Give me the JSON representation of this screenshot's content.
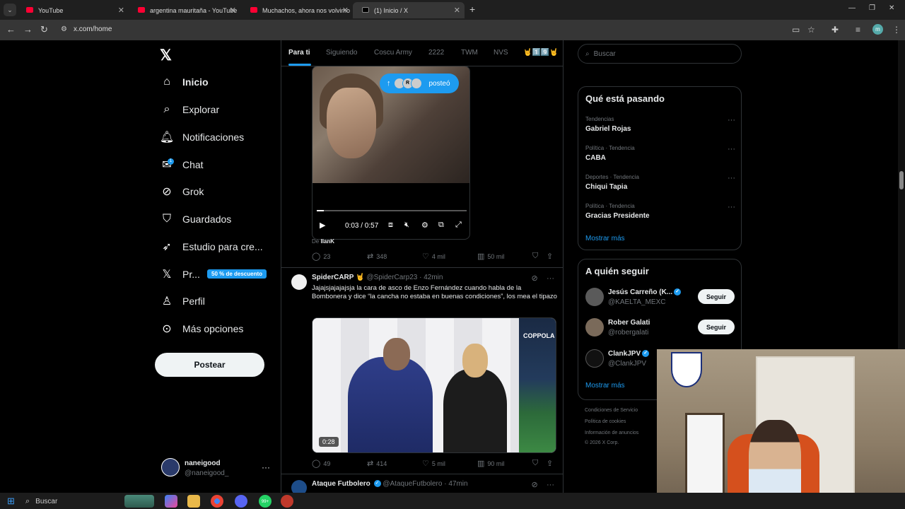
{
  "browser": {
    "tabs": [
      {
        "title": "YouTube"
      },
      {
        "title": "argentina mauritaña - YouTube"
      },
      {
        "title": "Muchachos, ahora nos volvimo"
      },
      {
        "title": "(1) Inicio / X"
      }
    ],
    "url": "x.com/home",
    "profile_initial": "m"
  },
  "nav": {
    "items": [
      {
        "label": "Inicio",
        "icon": "home-icon"
      },
      {
        "label": "Explorar",
        "icon": "search-icon"
      },
      {
        "label": "Notificaciones",
        "icon": "bell-icon"
      },
      {
        "label": "Chat",
        "icon": "mail-icon",
        "badge": "1"
      },
      {
        "label": "Grok",
        "icon": "grok-icon"
      },
      {
        "label": "Guardados",
        "icon": "bookmark-icon"
      },
      {
        "label": "Estudio para cre...",
        "icon": "rocket-icon"
      },
      {
        "label": "Pr...",
        "icon": "x-logo-icon"
      },
      {
        "label": "Perfil",
        "icon": "person-icon"
      },
      {
        "label": "Más opciones",
        "icon": "more-circle-icon"
      }
    ],
    "premium_badge": "50 % de descuento",
    "post_button": "Postear",
    "account": {
      "name": "naneigood",
      "handle": "@naneigood_"
    }
  },
  "feed": {
    "tabs": [
      "Para ti",
      "Siguiendo",
      "Coscu Army",
      "2222",
      "TWM",
      "NVS",
      "🤘1️⃣9️⃣🤘"
    ],
    "new_posts_label": "posteó",
    "tweet1": {
      "video_time": "0:03 / 0:57",
      "from_prefix": "De",
      "from_name": "IlanK",
      "replies": "23",
      "reposts": "348",
      "likes": "4 mil",
      "views": "50 mil"
    },
    "tweet2": {
      "name": "SpiderCARP",
      "handle": "@SpiderCarp23",
      "time": "· 42min",
      "text": "Jajajsjajajajsja la cara de asco de Enzo Fernández cuando habla de la Bombonera y dice “la cancha no estaba en buenas condiciones”, los mea el tipazo",
      "video_time": "0:28",
      "video_brand": "COPPOLA",
      "replies": "49",
      "reposts": "414",
      "likes": "5 mil",
      "views": "90 mil"
    },
    "tweet3": {
      "name": "Ataque Futbolero",
      "handle": "@AtaqueFutbolero",
      "time": "· 47min"
    }
  },
  "sidebar": {
    "search_placeholder": "Buscar",
    "trending_title": "Qué está pasando",
    "trends": [
      {
        "meta": "Tendencias",
        "title": "Gabriel Rojas"
      },
      {
        "meta": "Política · Tendencia",
        "title": "CABA"
      },
      {
        "meta": "Deportes · Tendencia",
        "title": "Chiqui Tapia"
      },
      {
        "meta": "Política · Tendencia",
        "title": "Gracias Presidente"
      }
    ],
    "show_more": "Mostrar más",
    "who_to_follow_title": "A quién seguir",
    "follow": [
      {
        "name": "Jesús Carreño (K...",
        "handle": "@KAELTA_MEXC",
        "button": "Seguir"
      },
      {
        "name": "Rober Galati",
        "handle": "@robergalati",
        "button": "Seguir"
      },
      {
        "name": "ClankJPV",
        "handle": "@ClankJPV",
        "button": ""
      }
    ],
    "show_more_follow": "Mostrar más",
    "footer": [
      "Condiciones de Servicio",
      "Política de cookies",
      "Información de anuncios",
      "© 2026 X Corp."
    ]
  },
  "taskbar": {
    "search_label": "Buscar",
    "badge": "99+"
  },
  "colors": {
    "accent": "#1d9bf0",
    "background": "#000000",
    "text": "#e7e9ea",
    "muted": "#71767b"
  }
}
